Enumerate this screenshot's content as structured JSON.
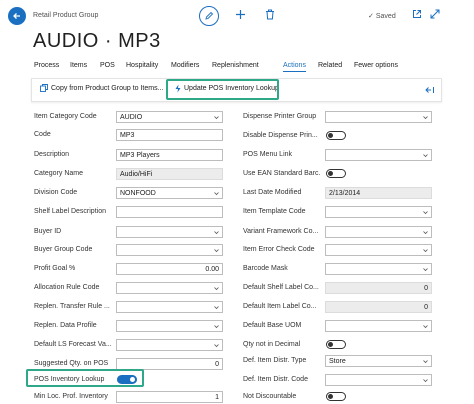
{
  "header": {
    "caption": "Retail Product Group",
    "title": "AUDIO · MP3",
    "saved_label": "Saved"
  },
  "tabs": [
    {
      "label": "Process"
    },
    {
      "label": "Items"
    },
    {
      "label": "POS"
    },
    {
      "label": "Hospitality"
    },
    {
      "label": "Modifiers"
    },
    {
      "label": "Replenishment"
    },
    {
      "label": "Actions"
    },
    {
      "label": "Related"
    },
    {
      "label": "Fewer options"
    }
  ],
  "actions": {
    "copy_label": "Copy from Product Group to Items...",
    "update_label": "Update POS Inventory Lookup"
  },
  "left_fields": [
    {
      "label": "Item Category Code",
      "value": "AUDIO"
    },
    {
      "label": "Code",
      "value": "MP3"
    },
    {
      "label": "Description",
      "value": "MP3 Players"
    },
    {
      "label": "Category Name",
      "value": "Audio/HiFi"
    },
    {
      "label": "Division Code",
      "value": "NONFOOD"
    },
    {
      "label": "Shelf Label Description",
      "value": ""
    },
    {
      "label": "Buyer ID",
      "value": ""
    },
    {
      "label": "Buyer Group Code",
      "value": ""
    },
    {
      "label": "Profit Goal %",
      "value": "0.00"
    },
    {
      "label": "Allocation Rule Code",
      "value": ""
    },
    {
      "label": "Replen. Transfer Rule ...",
      "value": ""
    },
    {
      "label": "Replen. Data Profile",
      "value": ""
    },
    {
      "label": "Default LS Forecast Va...",
      "value": ""
    },
    {
      "label": "Suggested Qty. on POS",
      "value": "0"
    },
    {
      "label": "POS Inventory Lookup",
      "value": ""
    },
    {
      "label": "Min Loc. Prof. Inventory",
      "value": "1"
    }
  ],
  "right_fields": [
    {
      "label": "Dispense Printer Group",
      "value": ""
    },
    {
      "label": "Disable Dispense Prin...",
      "value": ""
    },
    {
      "label": "POS Menu Link",
      "value": ""
    },
    {
      "label": "Use EAN Standard Barc.",
      "value": ""
    },
    {
      "label": "Last Date Modified",
      "value": "2/13/2014"
    },
    {
      "label": "Item Template Code",
      "value": ""
    },
    {
      "label": "Variant Framework Co...",
      "value": ""
    },
    {
      "label": "Item Error Check Code",
      "value": ""
    },
    {
      "label": "Barcode Mask",
      "value": ""
    },
    {
      "label": "Default Shelf Label Co...",
      "value": "0"
    },
    {
      "label": "Default Item Label Co...",
      "value": "0"
    },
    {
      "label": "Default Base UOM",
      "value": ""
    },
    {
      "label": "Qty not in Decimal",
      "value": ""
    },
    {
      "label": "Def. Item Distr. Type",
      "value": "Store"
    },
    {
      "label": "Def. Item Distr. Code",
      "value": ""
    },
    {
      "label": "Not Discountable",
      "value": ""
    }
  ],
  "colors": {
    "accent": "#1a6fc0",
    "highlight": "#2fa88a"
  }
}
